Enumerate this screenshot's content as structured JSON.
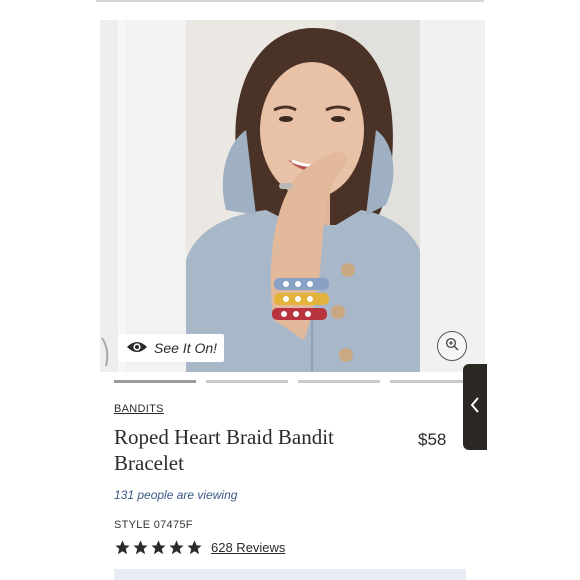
{
  "gallery": {
    "see_it_on_label": "See It On!",
    "slide_count": 4,
    "active_slide": 1
  },
  "product": {
    "brand": "BANDITS",
    "title": "Roped Heart Braid Bandit Bracelet",
    "price": "$58",
    "viewing_text": "131 people are viewing",
    "style_label": "STYLE 07475F",
    "rating": 5,
    "reviews_label": "628 Reviews"
  },
  "colors": {
    "link_blue": "#3a5a86",
    "side_tab": "#2b2722",
    "text": "#2b2b2b"
  },
  "icons": {
    "see_it_on": "eye-icon",
    "zoom": "zoom-in-icon",
    "side_tab": "chevron-left-icon",
    "rating": "star-icon"
  }
}
